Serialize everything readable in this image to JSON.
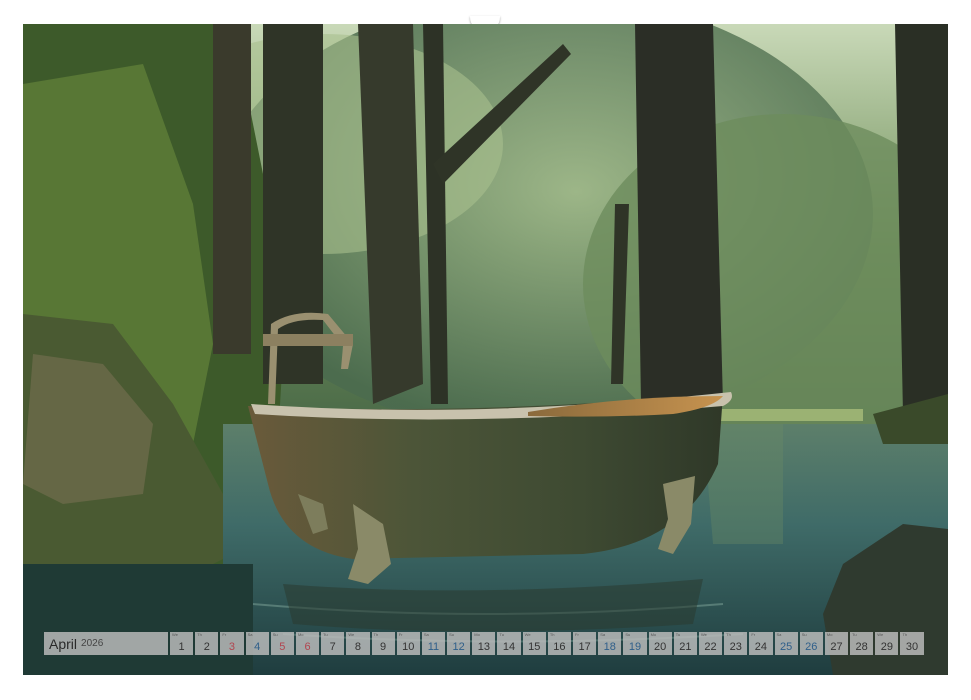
{
  "calendar": {
    "month": "April",
    "year": "2026",
    "days": [
      {
        "num": "1",
        "wd": "We",
        "type": "weekday"
      },
      {
        "num": "2",
        "wd": "Th",
        "type": "weekday"
      },
      {
        "num": "3",
        "wd": "Fr",
        "type": "sun"
      },
      {
        "num": "4",
        "wd": "Sa",
        "type": "sat"
      },
      {
        "num": "5",
        "wd": "Su",
        "type": "sun"
      },
      {
        "num": "6",
        "wd": "Mo",
        "type": "sun"
      },
      {
        "num": "7",
        "wd": "Tu",
        "type": "weekday"
      },
      {
        "num": "8",
        "wd": "We",
        "type": "weekday"
      },
      {
        "num": "9",
        "wd": "Th",
        "type": "weekday"
      },
      {
        "num": "10",
        "wd": "Fr",
        "type": "weekday"
      },
      {
        "num": "11",
        "wd": "Sa",
        "type": "sat"
      },
      {
        "num": "12",
        "wd": "Su",
        "type": "sat"
      },
      {
        "num": "13",
        "wd": "Mo",
        "type": "weekday"
      },
      {
        "num": "14",
        "wd": "Tu",
        "type": "weekday"
      },
      {
        "num": "15",
        "wd": "We",
        "type": "weekday"
      },
      {
        "num": "16",
        "wd": "Th",
        "type": "weekday"
      },
      {
        "num": "17",
        "wd": "Fr",
        "type": "weekday"
      },
      {
        "num": "18",
        "wd": "Sa",
        "type": "sat"
      },
      {
        "num": "19",
        "wd": "Su",
        "type": "sat"
      },
      {
        "num": "20",
        "wd": "Mo",
        "type": "weekday"
      },
      {
        "num": "21",
        "wd": "Tu",
        "type": "weekday"
      },
      {
        "num": "22",
        "wd": "We",
        "type": "weekday"
      },
      {
        "num": "23",
        "wd": "Th",
        "type": "weekday"
      },
      {
        "num": "24",
        "wd": "Fr",
        "type": "weekday"
      },
      {
        "num": "25",
        "wd": "Sa",
        "type": "sat"
      },
      {
        "num": "26",
        "wd": "Su",
        "type": "sat"
      },
      {
        "num": "27",
        "wd": "Mo",
        "type": "weekday"
      },
      {
        "num": "28",
        "wd": "Tu",
        "type": "weekday"
      },
      {
        "num": "29",
        "wd": "We",
        "type": "weekday"
      },
      {
        "num": "30",
        "wd": "Th",
        "type": "weekday"
      }
    ]
  },
  "colors": {
    "sunday_holiday": "#b2454f",
    "saturday": "#2f5f8a",
    "strip": "#bebebe"
  }
}
